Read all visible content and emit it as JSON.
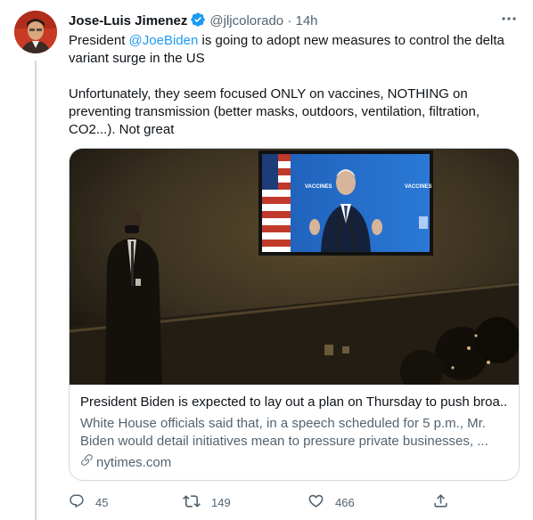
{
  "author": {
    "name": "Jose-Luis Jimenez",
    "handle": "@jljcolorado",
    "separator": "·",
    "time": "14h"
  },
  "tweet": {
    "line1_prefix": "President ",
    "mention": "@JoeBiden",
    "line1_suffix": " is going to adopt new measures to control the delta variant surge in the US",
    "paragraph2": "Unfortunately, they seem focused ONLY on vaccines, NOTHING on preventing transmission (better masks, outdoors, ventilation, filtration, CO2...). Not great"
  },
  "card": {
    "screen_banner_left": "VACCINES",
    "screen_banner_right": "VACCINES",
    "title": "President Biden is expected to lay out a plan on Thursday to push broa...",
    "description_line1": "White House officials said that, in a speech scheduled for 5 p.m., Mr.",
    "description_line2": "Biden would detail initiatives mean to pressure private businesses, ...",
    "domain": "nytimes.com"
  },
  "actions": {
    "replies": "45",
    "retweets": "149",
    "likes": "466"
  },
  "colors": {
    "accent": "#1d9bf0",
    "text": "#0f1419",
    "secondary": "#536471",
    "border": "#cfd9de",
    "retweet_icon": "#536471"
  },
  "icons": [
    "verified-badge-icon",
    "more-icon",
    "link-icon",
    "reply-icon",
    "retweet-icon",
    "like-icon",
    "share-icon"
  ]
}
